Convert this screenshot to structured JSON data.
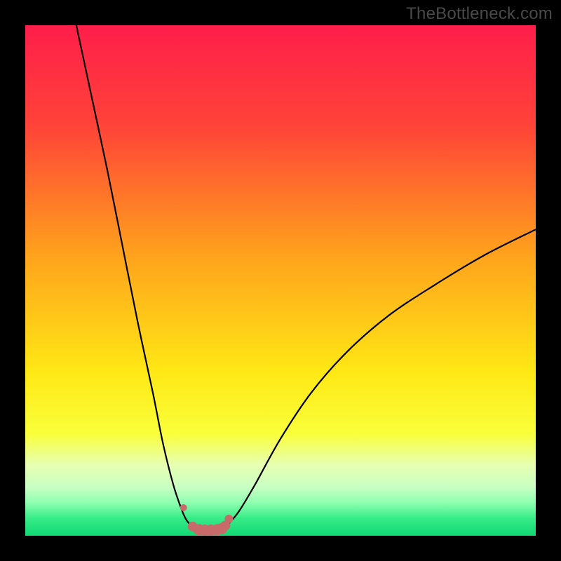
{
  "watermark": {
    "text": "TheBottleneck.com"
  },
  "colors": {
    "frame": "#000000",
    "curve": "#000000",
    "markers": "#c96a6a",
    "gradient_stops": [
      {
        "offset": 0.0,
        "color": "#ff1e4a"
      },
      {
        "offset": 0.2,
        "color": "#ff4438"
      },
      {
        "offset": 0.45,
        "color": "#ffa21c"
      },
      {
        "offset": 0.68,
        "color": "#ffe815"
      },
      {
        "offset": 0.8,
        "color": "#f9ff3a"
      },
      {
        "offset": 0.86,
        "color": "#e8ffb0"
      },
      {
        "offset": 0.905,
        "color": "#c8ffc3"
      },
      {
        "offset": 0.935,
        "color": "#8fffb0"
      },
      {
        "offset": 0.965,
        "color": "#38ec88"
      },
      {
        "offset": 1.0,
        "color": "#0fd873"
      }
    ]
  },
  "chart_data": {
    "type": "line",
    "title": "",
    "xlabel": "",
    "ylabel": "",
    "xlim": [
      0,
      100
    ],
    "ylim": [
      0,
      100
    ],
    "grid": false,
    "legend": false,
    "series": [
      {
        "name": "left-branch",
        "x": [
          10,
          13,
          16,
          19,
          22,
          25,
          27,
          29,
          30.5,
          31.5,
          32.5,
          33,
          33.2
        ],
        "y": [
          100,
          86,
          72,
          57,
          42,
          28,
          18,
          10,
          5.5,
          3.2,
          2.0,
          1.4,
          1.3
        ]
      },
      {
        "name": "right-branch",
        "x": [
          38,
          39,
          40,
          42,
          45,
          50,
          56,
          63,
          71,
          80,
          90,
          100
        ],
        "y": [
          1.3,
          1.6,
          2.5,
          5.0,
          10,
          19,
          28,
          36,
          43,
          49,
          55,
          60
        ]
      },
      {
        "name": "valley-floor",
        "x": [
          33.2,
          34,
          35,
          36,
          37,
          38
        ],
        "y": [
          1.3,
          1.1,
          1.05,
          1.05,
          1.1,
          1.3
        ]
      }
    ],
    "markers": {
      "name": "valley-markers",
      "x": [
        31.0,
        32.8,
        34.0,
        35.2,
        36.4,
        37.6,
        38.5,
        39.2,
        39.9
      ],
      "y": [
        5.5,
        1.8,
        1.2,
        1.1,
        1.1,
        1.2,
        1.4,
        2.0,
        3.3
      ],
      "r": [
        5,
        7,
        8,
        8,
        8,
        8,
        8,
        7,
        6
      ]
    }
  }
}
